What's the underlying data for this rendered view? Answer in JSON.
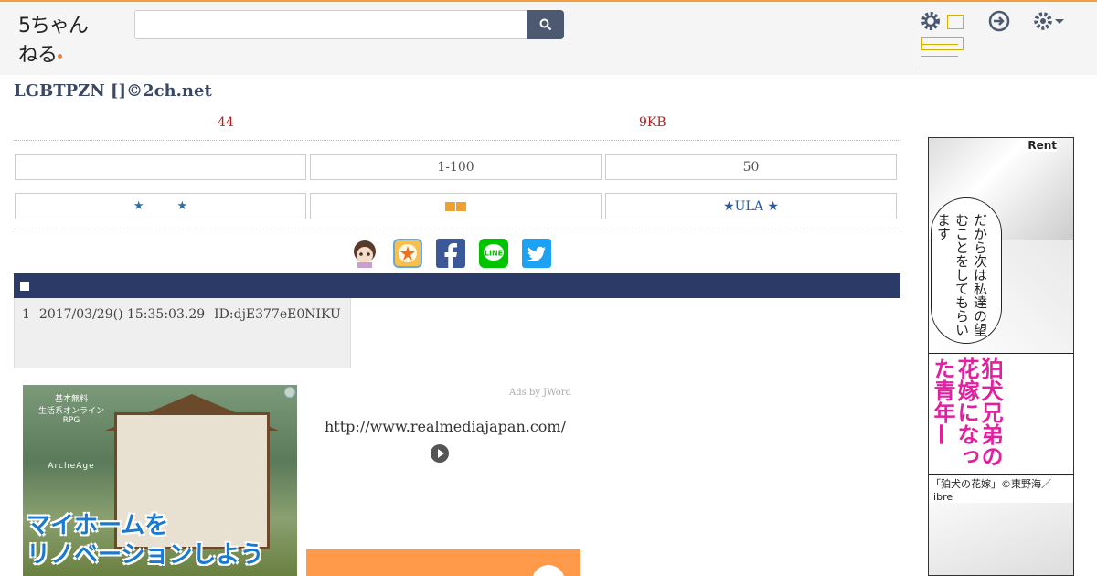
{
  "header": {
    "logo_text": "5ちゃんねる",
    "search_value": "",
    "search_icon": "search-icon",
    "icons": [
      "settings-gear-icon",
      "login-icon",
      "gear-dropdown-icon"
    ]
  },
  "thread": {
    "title": "LGBTPZN []©2ch.net",
    "post_count": "44",
    "size": "9KB"
  },
  "nav": {
    "row1": [
      "",
      "1-100",
      "50"
    ],
    "row2_ula": "★ULA ★",
    "row2_star": "★"
  },
  "share": [
    "avatar-icon",
    "app-icon",
    "facebook-icon",
    "line-icon",
    "twitter-icon"
  ],
  "posts": [
    {
      "num": "1",
      "date": "2017/03/29() 15:35:03.29",
      "id": "ID:djE377eE0NIKU"
    }
  ],
  "ads": {
    "left": {
      "badge_line1": "基本無料",
      "badge_line2": "生活系オンラインRPG",
      "brand": "ArcheAge",
      "copy_line1": "マイホームを",
      "copy_line2": "リノベーションしよう"
    },
    "middle": {
      "by": "Ads by JWord",
      "url": "http://www.realmediajapan.com/"
    },
    "right": {
      "rent": "Rent",
      "bubble": "だから次は私達の望むことをしてもらいます",
      "title": "狛犬兄弟の花嫁になった青年—",
      "credit": "「狛犬の花嫁」©東野海／libre"
    }
  },
  "colors": {
    "accent_top": "#f0a040",
    "thread_bar": "#2b3a66",
    "count_red": "#b02020"
  }
}
